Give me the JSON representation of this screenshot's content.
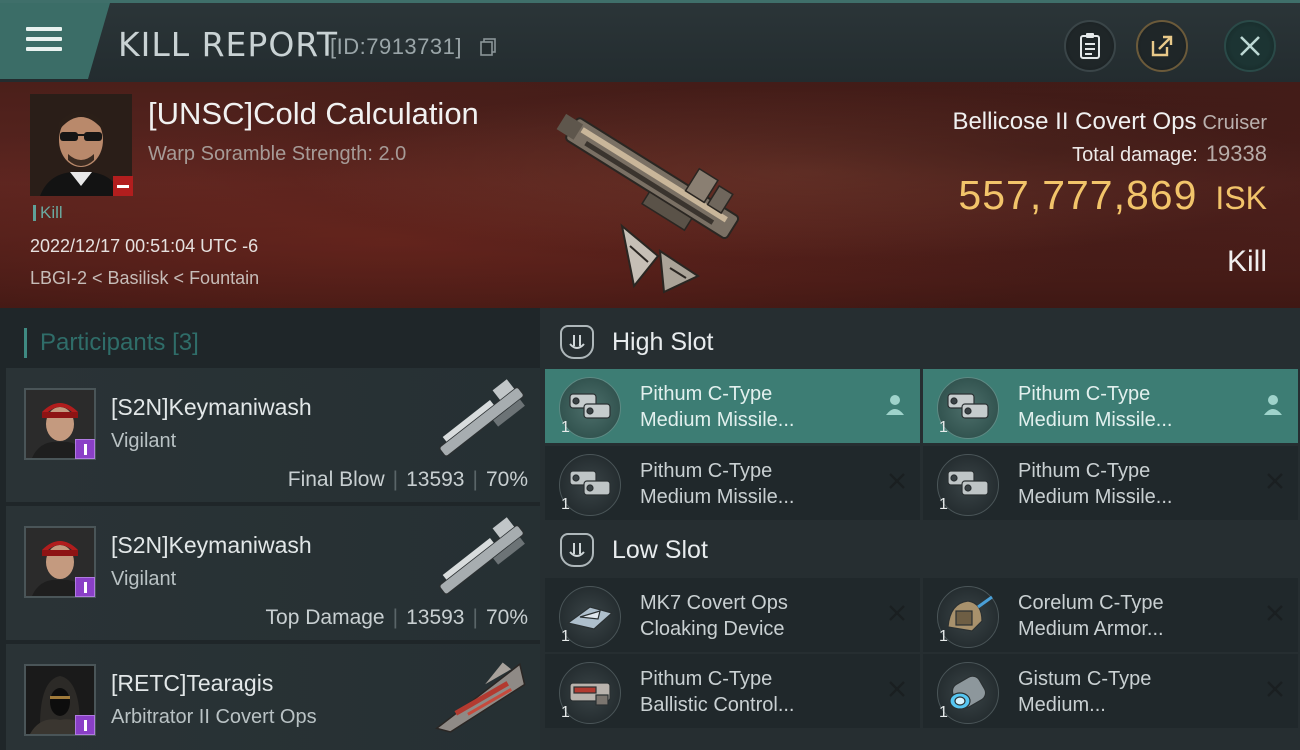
{
  "header": {
    "title": "KILL REPORT",
    "id_text": "[ID:7913731]"
  },
  "victim": {
    "name": "[UNSC]Cold Calculation",
    "scramble": "Warp Soramble Strength: 2.0",
    "kill_tag": "Kill",
    "timestamp": "2022/12/17 00:51:04 UTC -6",
    "location": "LBGI-2 < Basilisk < Fountain"
  },
  "ship": {
    "name": "Bellicose II Covert Ops",
    "class": "Cruiser",
    "total_damage_label": "Total damage:",
    "total_damage_value": "19338",
    "isk_value": "557,777,869",
    "isk_unit": "ISK",
    "result": "Kill"
  },
  "participants": {
    "header": "Participants",
    "count": "[3]",
    "items": [
      {
        "name": "[S2N]Keymaniwash",
        "ship": "Vigilant",
        "role": "Final Blow",
        "damage": "13593",
        "percent": "70%"
      },
      {
        "name": "[S2N]Keymaniwash",
        "ship": "Vigilant",
        "role": "Top Damage",
        "damage": "13593",
        "percent": "70%"
      },
      {
        "name": "[RETC]Tearagis",
        "ship": "Arbitrator II Covert Ops",
        "role": "",
        "damage": "",
        "percent": ""
      }
    ]
  },
  "fitting": {
    "high_slot_title": "High Slot",
    "low_slot_title": "Low Slot",
    "high": [
      {
        "line1": "Pithum C-Type",
        "line2": "Medium Missile...",
        "qty": "1",
        "status": "person"
      },
      {
        "line1": "Pithum C-Type",
        "line2": "Medium Missile...",
        "qty": "1",
        "status": "person"
      },
      {
        "line1": "Pithum C-Type",
        "line2": "Medium Missile...",
        "qty": "1",
        "status": "destroyed"
      },
      {
        "line1": "Pithum C-Type",
        "line2": "Medium Missile...",
        "qty": "1",
        "status": "destroyed"
      }
    ],
    "low": [
      {
        "line1": "MK7 Covert Ops",
        "line2": "Cloaking Device",
        "qty": "1",
        "status": "destroyed"
      },
      {
        "line1": "Corelum C-Type",
        "line2": "Medium Armor...",
        "qty": "1",
        "status": "destroyed"
      },
      {
        "line1": "Pithum C-Type",
        "line2": "Ballistic Control...",
        "qty": "1",
        "status": "destroyed"
      },
      {
        "line1": "Gistum C-Type",
        "line2": "Medium...",
        "qty": "1",
        "status": "destroyed"
      }
    ]
  },
  "colors": {
    "accent_teal": "#3d7d74",
    "isk_gold": "#f2c46a",
    "loss_red": "#b21e1e",
    "badge_purple": "#8a3fc7"
  },
  "icons": [
    "menu-icon",
    "copy-icon",
    "clipboard-icon",
    "share-icon",
    "close-icon",
    "slot-icon",
    "person-icon",
    "x-icon"
  ]
}
